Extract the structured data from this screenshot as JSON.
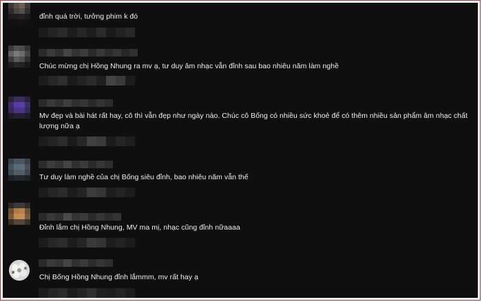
{
  "comments": [
    {
      "text": "đỉnh quá trời, tưởng phim k đó"
    },
    {
      "text": "Chúc mừng chị Hồng Nhung ra mv ạ, tư duy âm nhạc vẫn đỉnh sau bao nhiêu năm làm nghề"
    },
    {
      "text": "Mv đẹp và bài hát rất hay, cô thì vẫn đẹp như ngày nào. Chúc cô Bống có nhiều sức khoẻ để có thêm nhiều sản phẩm âm nhạc chất lượng nữa ạ"
    },
    {
      "text": "Tư duy làm nghề của chị Bống siêu đỉnh, bao nhiêu năm vẫn thế"
    },
    {
      "text": "Đỉnh lắm chị Hồng Nhung, MV ma mị, nhạc cũng đỉnh nữaaaa"
    },
    {
      "text": "Chị Bống Hồng Nhung đỉnh lắmmm, mv rất hay ạ"
    }
  ],
  "colors": {
    "frame_border": "#e8202a",
    "background": "#0f0f0f",
    "text": "#f1f1f1"
  }
}
